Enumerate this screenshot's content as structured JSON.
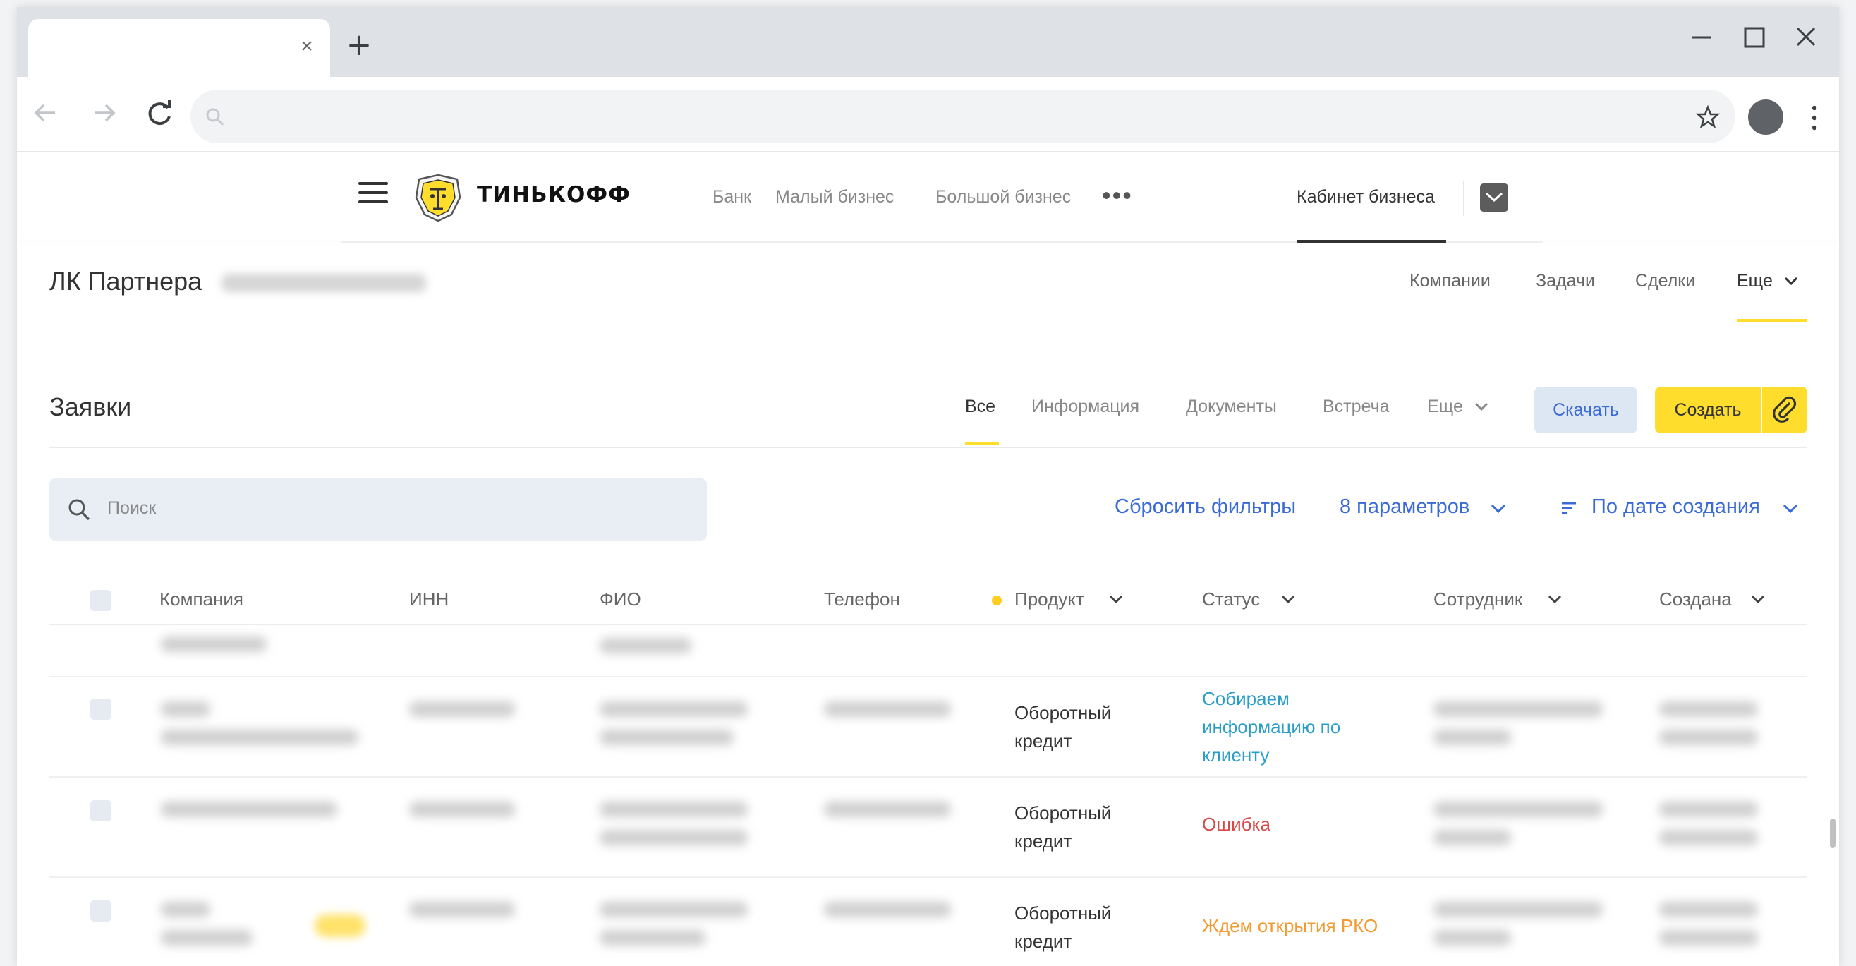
{
  "browser": {
    "tab_close": "×",
    "new_tab": "+",
    "icons": [
      "back-arrow-icon",
      "forward-arrow-icon",
      "reload-icon",
      "search-icon",
      "star-icon",
      "profile-icon",
      "kebab-menu-icon"
    ]
  },
  "site_header": {
    "logo_text": "ТИНЬКОФФ",
    "nav": [
      "Банк",
      "Малый бизнес",
      "Большой бизнес"
    ],
    "more": "•••",
    "cabinet": "Кабинет бизнеса"
  },
  "partner_bar": {
    "title": "ЛК Партнера",
    "nav": {
      "companies": "Компании",
      "tasks": "Задачи",
      "deals": "Сделки",
      "more": "Еще"
    }
  },
  "page": {
    "title": "Заявки",
    "tabs": {
      "all": "Все",
      "info": "Информация",
      "docs": "Документы",
      "meeting": "Встреча",
      "more": "Еще"
    },
    "download": "Скачать",
    "create": "Создать",
    "search_placeholder": "Поиск",
    "reset_filters": "Сбросить фильтры",
    "params": "8 параметров",
    "sort": "По дате создания"
  },
  "table": {
    "headers": {
      "company": "Компания",
      "inn": "ИНН",
      "fio": "ФИО",
      "phone": "Телефон",
      "product": "Продукт",
      "status": "Статус",
      "employee": "Сотрудник",
      "created": "Создана"
    },
    "rows": [
      {
        "product_line1": "Оборотный",
        "product_line2": "кредит",
        "status_l1": "Собираем",
        "status_l2": "информацию по",
        "status_l3": "клиенту"
      },
      {
        "product_line1": "Оборотный",
        "product_line2": "кредит",
        "status": "Ошибка"
      },
      {
        "product_line1": "Оборотный",
        "product_line2": "кредит",
        "status": "Ждем открытия РКО"
      }
    ]
  },
  "colors": {
    "accent_yellow": "#ffdd2d",
    "link_blue": "#3a6ad8",
    "status_collect": "#2a9ec8",
    "status_error": "#d74a4a",
    "status_wait": "#f29b33"
  }
}
